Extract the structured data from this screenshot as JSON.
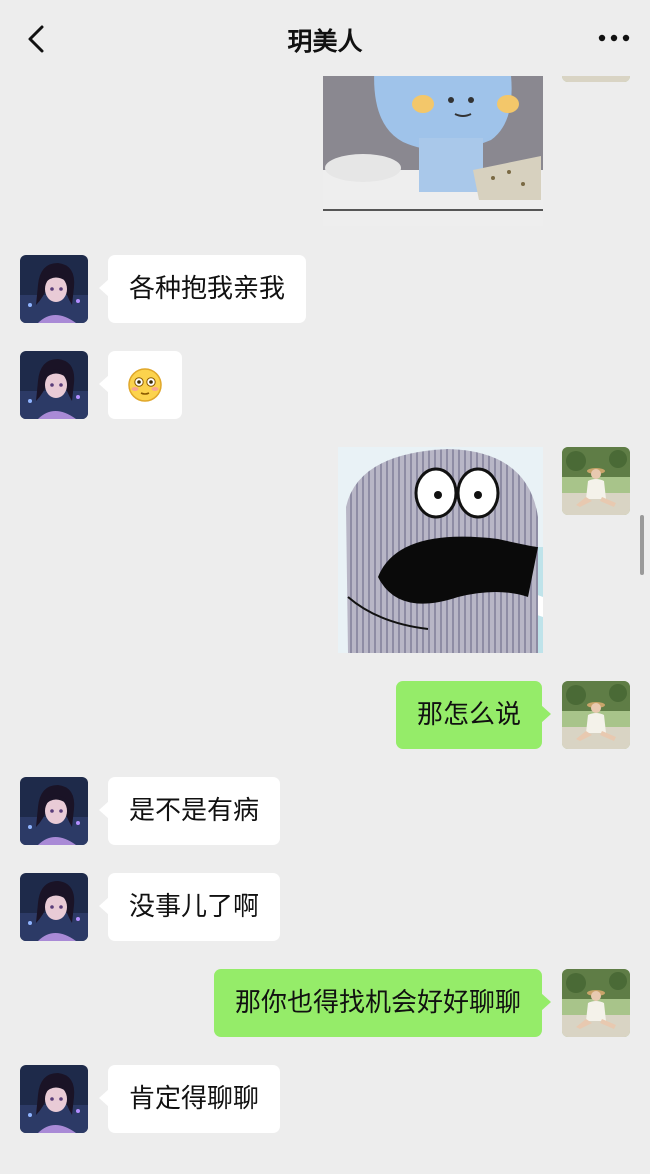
{
  "header": {
    "title": "玥美人"
  },
  "messages": [
    {
      "side": "out",
      "type": "sticker",
      "sticker": "blue-character-sticker"
    },
    {
      "side": "in",
      "type": "text",
      "text": "各种抱我亲我"
    },
    {
      "side": "in",
      "type": "emoji",
      "emoji": "😳"
    },
    {
      "side": "out",
      "type": "sticker",
      "sticker": "surprised-whale-sticker"
    },
    {
      "side": "out",
      "type": "text",
      "text": "那怎么说"
    },
    {
      "side": "in",
      "type": "text",
      "text": "是不是有病"
    },
    {
      "side": "in",
      "type": "text",
      "text": "没事儿了啊"
    },
    {
      "side": "out",
      "type": "text",
      "text": "那你也得找机会好好聊聊"
    },
    {
      "side": "in",
      "type": "text",
      "text": "肯定得聊聊"
    }
  ],
  "colors": {
    "background": "#ededed",
    "incoming_bubble": "#ffffff",
    "outgoing_bubble": "#95ec69"
  }
}
